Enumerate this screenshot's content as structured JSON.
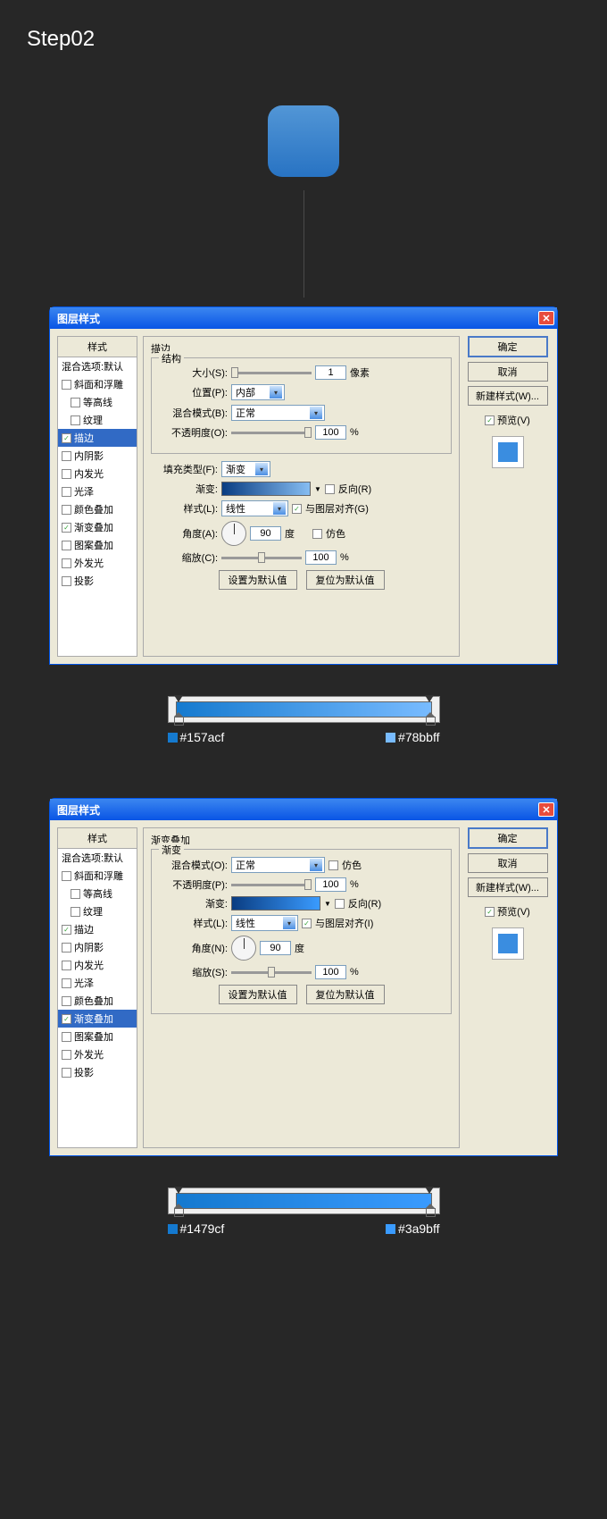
{
  "step_title": "Step02",
  "dialog_title": "图层样式",
  "styles_header": "样式",
  "blend_default": "混合选项:默认",
  "style_items": [
    {
      "label": "斜面和浮雕",
      "checked": false
    },
    {
      "label": "等高线",
      "checked": false,
      "indent": true
    },
    {
      "label": "纹理",
      "checked": false,
      "indent": true
    },
    {
      "label": "描边",
      "checked": true
    },
    {
      "label": "内阴影",
      "checked": false
    },
    {
      "label": "内发光",
      "checked": false
    },
    {
      "label": "光泽",
      "checked": false
    },
    {
      "label": "颜色叠加",
      "checked": false
    },
    {
      "label": "渐变叠加",
      "checked": true
    },
    {
      "label": "图案叠加",
      "checked": false
    },
    {
      "label": "外发光",
      "checked": false
    },
    {
      "label": "投影",
      "checked": false
    }
  ],
  "stroke": {
    "title": "描边",
    "group1": "结构",
    "size_label": "大小(S):",
    "size_value": "1",
    "size_unit": "像素",
    "position_label": "位置(P):",
    "position_value": "内部",
    "blend_label": "混合模式(B):",
    "blend_value": "正常",
    "opacity_label": "不透明度(O):",
    "opacity_value": "100",
    "opacity_unit": "%",
    "fill_type_label": "填充类型(F):",
    "fill_type_value": "渐变",
    "gradient_label": "渐变:",
    "reverse_label": "反向(R)",
    "style_label": "样式(L):",
    "style_value": "线性",
    "align_label": "与图层对齐(G)",
    "angle_label": "角度(A):",
    "angle_value": "90",
    "angle_unit": "度",
    "dither_label": "仿色",
    "scale_label": "缩放(C):",
    "scale_value": "100",
    "scale_unit": "%"
  },
  "grad_overlay": {
    "title": "渐变叠加",
    "group": "渐变",
    "blend_label": "混合模式(O):",
    "blend_value": "正常",
    "dither_label": "仿色",
    "opacity_label": "不透明度(P):",
    "opacity_value": "100",
    "opacity_unit": "%",
    "gradient_label": "渐变:",
    "reverse_label": "反向(R)",
    "style_label": "样式(L):",
    "style_value": "线性",
    "align_label": "与图层对齐(I)",
    "angle_label": "角度(N):",
    "angle_value": "90",
    "angle_unit": "度",
    "scale_label": "缩放(S):",
    "scale_value": "100",
    "scale_unit": "%"
  },
  "btn_default": "设置为默认值",
  "btn_reset": "复位为默认值",
  "btn_ok": "确定",
  "btn_cancel": "取消",
  "btn_new_style": "新建样式(W)...",
  "preview_label": "预览(V)",
  "grad1": {
    "c1": "#157acf",
    "c2": "#78bbff"
  },
  "grad2": {
    "c1": "#1479cf",
    "c2": "#3a9bff"
  }
}
